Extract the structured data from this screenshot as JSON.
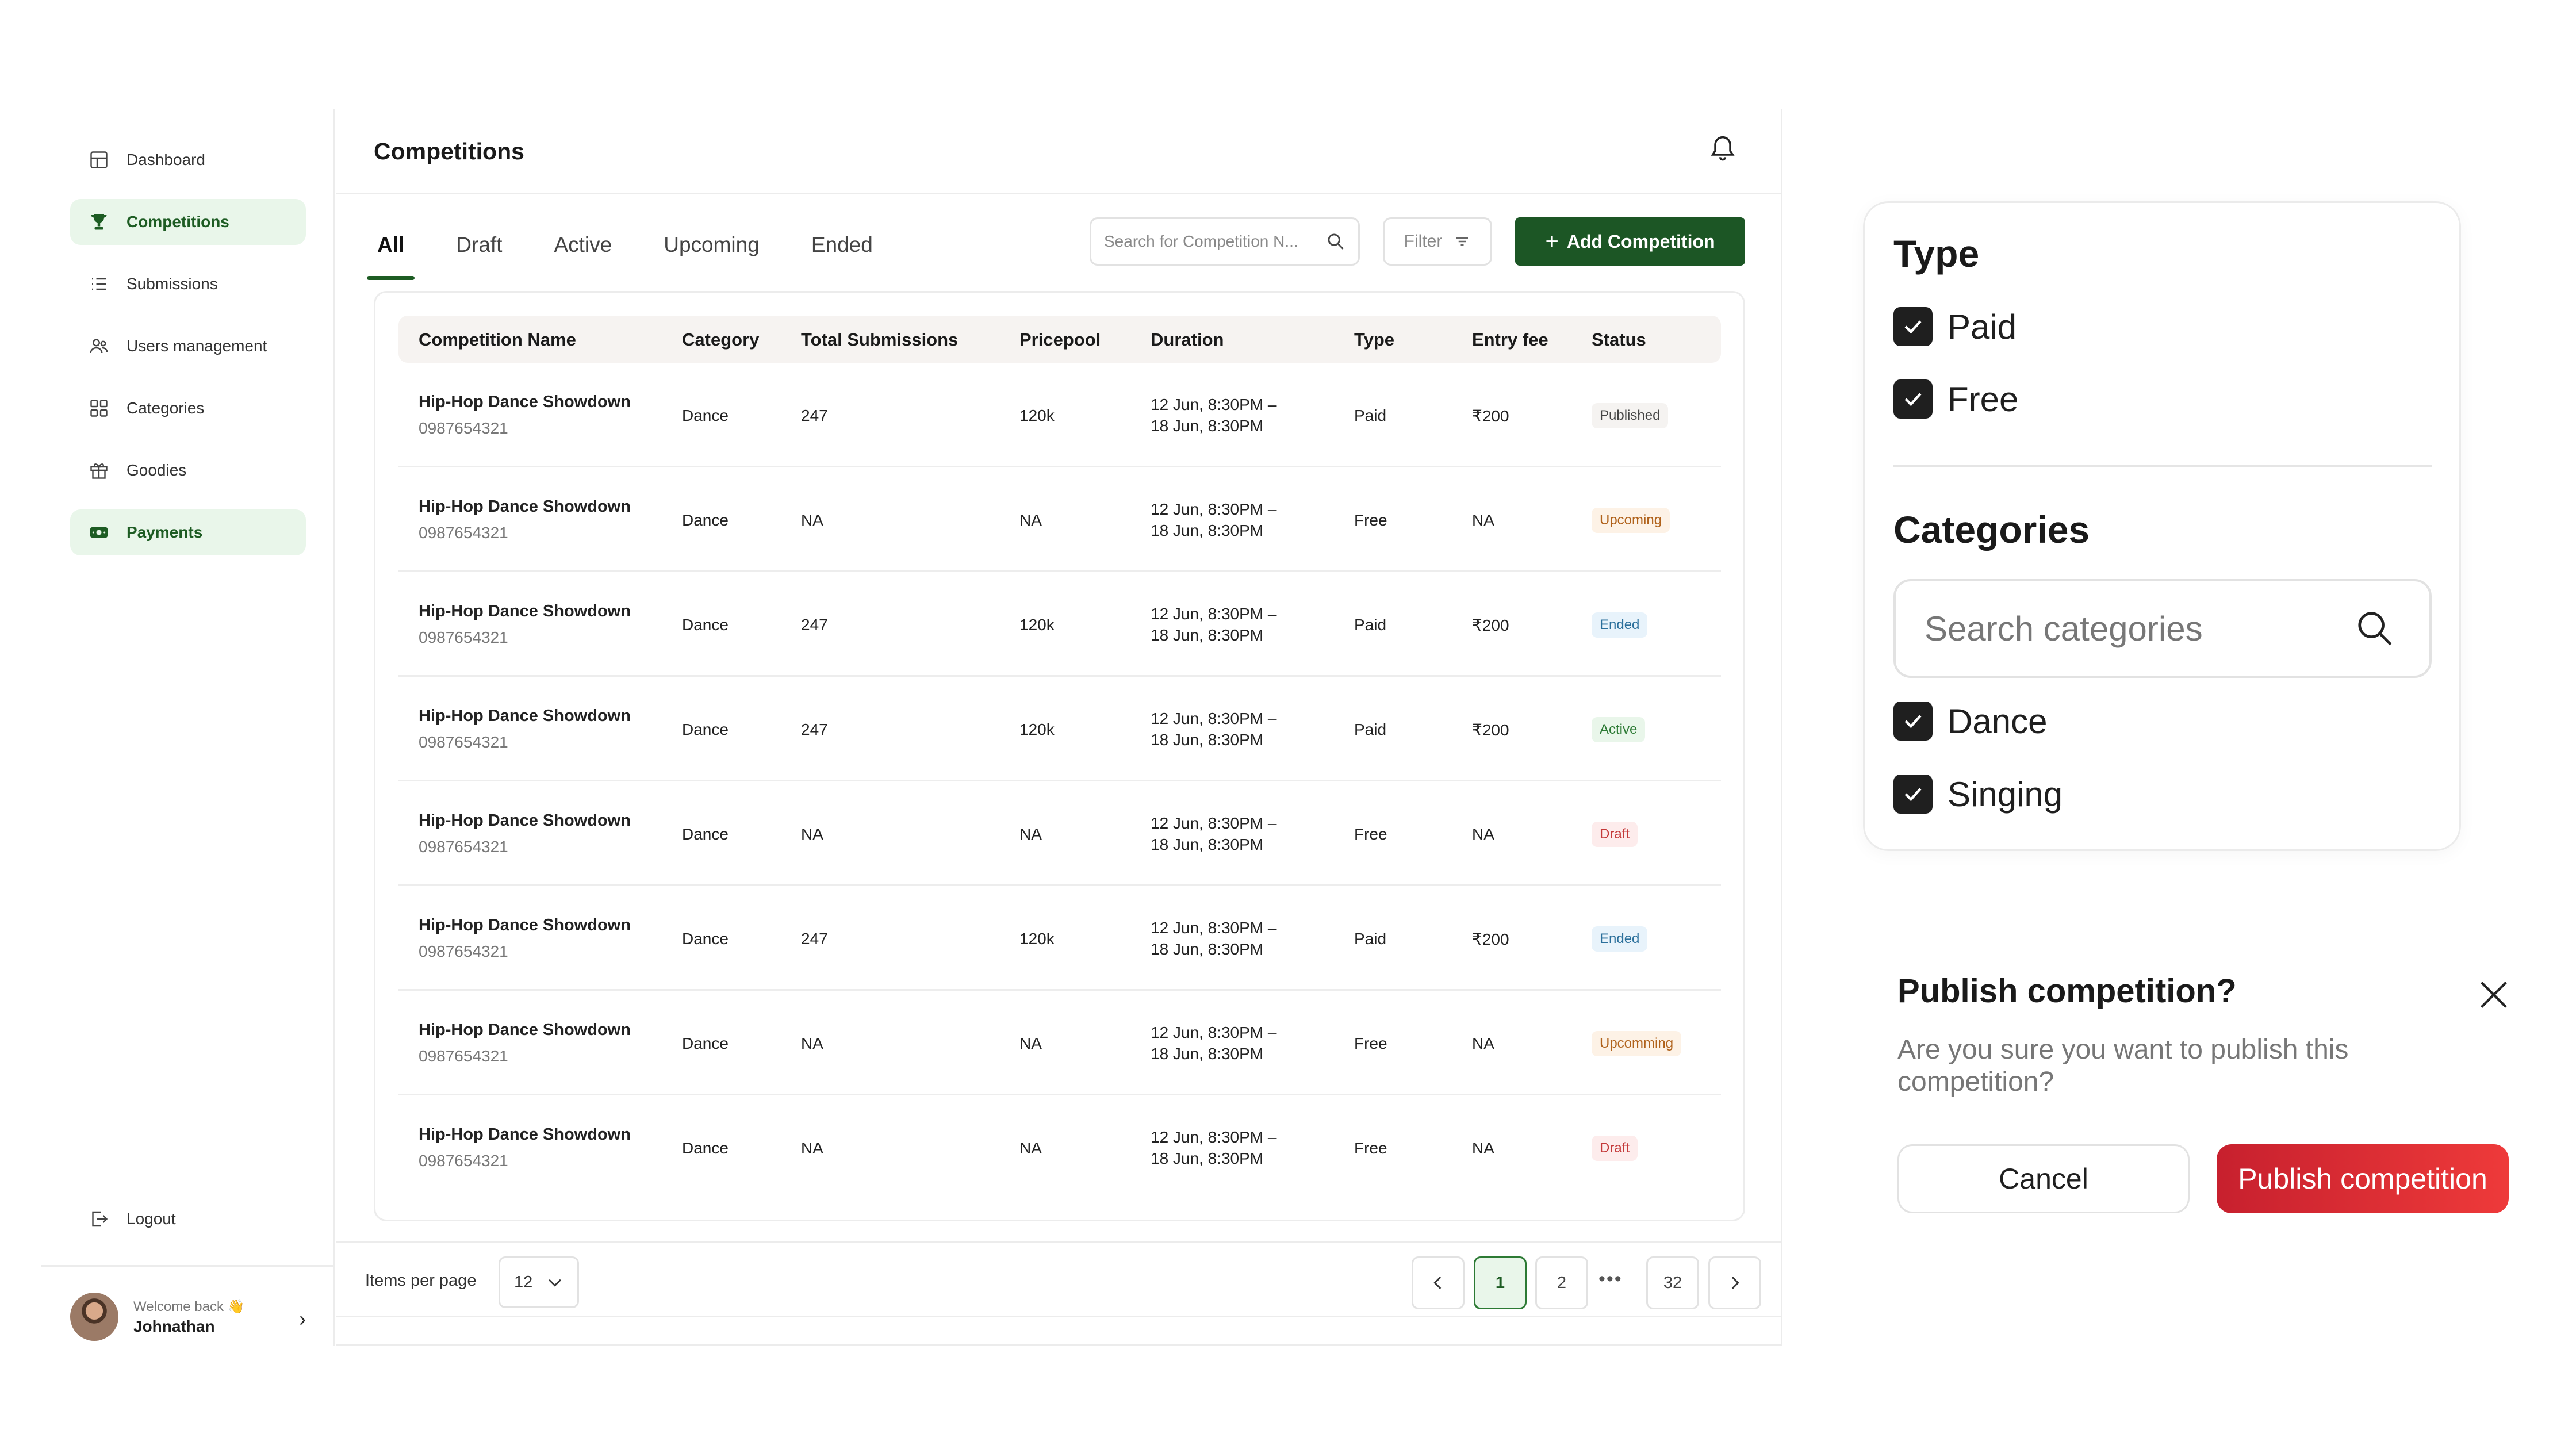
{
  "sidebar": {
    "items": [
      {
        "label": "Dashboard",
        "icon": "dashboard-icon"
      },
      {
        "label": "Competitions",
        "icon": "trophy-icon"
      },
      {
        "label": "Submissions",
        "icon": "list-icon"
      },
      {
        "label": "Users management",
        "icon": "users-icon"
      },
      {
        "label": "Categories",
        "icon": "grid-icon"
      },
      {
        "label": "Goodies",
        "icon": "gift-icon"
      },
      {
        "label": "Payments",
        "icon": "cash-icon"
      }
    ],
    "logout": "Logout",
    "user": {
      "welcome": "Welcome back 👋",
      "name": "Johnathan"
    }
  },
  "header": {
    "title": "Competitions"
  },
  "tabs": [
    "All",
    "Draft",
    "Active",
    "Upcoming",
    "Ended"
  ],
  "toolbar": {
    "search_placeholder": "Search for Competition N...",
    "filter_label": "Filter",
    "add_label": "Add Competition"
  },
  "table": {
    "columns": [
      "Competition Name",
      "Category",
      "Total Submissions",
      "Pricepool",
      "Duration",
      "Type",
      "Entry fee",
      "Status"
    ],
    "rows": [
      {
        "name": "Hip-Hop Dance Showdown",
        "id": "0987654321",
        "category": "Dance",
        "submissions": "247",
        "pricepool": "120k",
        "duration_start": "12 Jun, 8:30PM –",
        "duration_end": "18 Jun, 8:30PM",
        "type": "Paid",
        "fee": "₹200",
        "status": "Published",
        "status_kind": "published"
      },
      {
        "name": "Hip-Hop Dance Showdown",
        "id": "0987654321",
        "category": "Dance",
        "submissions": "NA",
        "pricepool": "NA",
        "duration_start": "12 Jun, 8:30PM –",
        "duration_end": "18 Jun, 8:30PM",
        "type": "Free",
        "fee": "NA",
        "status": "Upcoming",
        "status_kind": "upcoming"
      },
      {
        "name": "Hip-Hop Dance Showdown",
        "id": "0987654321",
        "category": "Dance",
        "submissions": "247",
        "pricepool": "120k",
        "duration_start": "12 Jun, 8:30PM –",
        "duration_end": "18 Jun, 8:30PM",
        "type": "Paid",
        "fee": "₹200",
        "status": "Ended",
        "status_kind": "ended"
      },
      {
        "name": "Hip-Hop Dance Showdown",
        "id": "0987654321",
        "category": "Dance",
        "submissions": "247",
        "pricepool": "120k",
        "duration_start": "12 Jun, 8:30PM –",
        "duration_end": "18 Jun, 8:30PM",
        "type": "Paid",
        "fee": "₹200",
        "status": "Active",
        "status_kind": "active"
      },
      {
        "name": "Hip-Hop Dance Showdown",
        "id": "0987654321",
        "category": "Dance",
        "submissions": "NA",
        "pricepool": "NA",
        "duration_start": "12 Jun, 8:30PM –",
        "duration_end": "18 Jun, 8:30PM",
        "type": "Free",
        "fee": "NA",
        "status": "Draft",
        "status_kind": "draft"
      },
      {
        "name": "Hip-Hop Dance Showdown",
        "id": "0987654321",
        "category": "Dance",
        "submissions": "247",
        "pricepool": "120k",
        "duration_start": "12 Jun, 8:30PM –",
        "duration_end": "18 Jun, 8:30PM",
        "type": "Paid",
        "fee": "₹200",
        "status": "Ended",
        "status_kind": "ended"
      },
      {
        "name": "Hip-Hop Dance Showdown",
        "id": "0987654321",
        "category": "Dance",
        "submissions": "NA",
        "pricepool": "NA",
        "duration_start": "12 Jun, 8:30PM –",
        "duration_end": "18 Jun, 8:30PM",
        "type": "Free",
        "fee": "NA",
        "status": "Upcomming",
        "status_kind": "upcoming"
      },
      {
        "name": "Hip-Hop Dance Showdown",
        "id": "0987654321",
        "category": "Dance",
        "submissions": "NA",
        "pricepool": "NA",
        "duration_start": "12 Jun, 8:30PM –",
        "duration_end": "18 Jun, 8:30PM",
        "type": "Free",
        "fee": "NA",
        "status": "Draft",
        "status_kind": "draft"
      }
    ]
  },
  "pagination": {
    "items_per_page_label": "Items per page",
    "items_per_page": "12",
    "pages": [
      "1",
      "2",
      "32"
    ],
    "current": "1",
    "ellipsis": "•••"
  },
  "filter_panel": {
    "type_title": "Type",
    "types": [
      {
        "label": "Paid",
        "checked": true
      },
      {
        "label": "Free",
        "checked": true
      }
    ],
    "categories_title": "Categories",
    "search_placeholder": "Search categories",
    "categories": [
      {
        "label": "Dance",
        "checked": true
      },
      {
        "label": "Singing",
        "checked": true
      }
    ]
  },
  "dialog": {
    "title": "Publish competition?",
    "message": "Are you sure you want to publish this competition?",
    "cancel": "Cancel",
    "confirm": "Publish competition"
  },
  "colors": {
    "brand_green": "#1c5625",
    "active_nav_bg": "#e9f6ea",
    "publish_red": "#e02d35"
  }
}
